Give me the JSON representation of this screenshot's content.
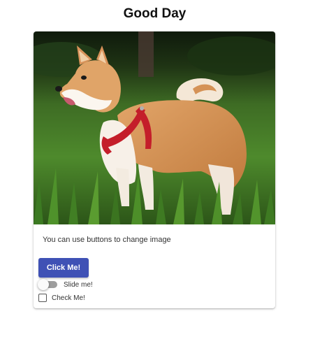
{
  "page": {
    "title": "Good Day"
  },
  "card": {
    "image_subject": "shiba inu dog on grass",
    "text": "You can use buttons to change image",
    "button_label": "Click Me!",
    "switch": {
      "label": "Slide me!",
      "checked": false
    },
    "checkbox": {
      "label": "Check Me!",
      "checked": false
    }
  },
  "colors": {
    "button": "#3f51b5",
    "switch_track": "#9e9e9e"
  }
}
